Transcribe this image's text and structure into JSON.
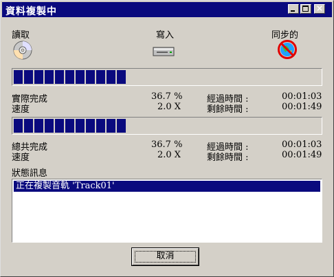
{
  "window": {
    "title": "資料複製中"
  },
  "titlebar": {
    "minimize_icon": "minimize-icon",
    "maximize_icon": "maximize-icon",
    "close_label": "×"
  },
  "header": {
    "read_label": "讀取",
    "write_label": "寫入",
    "sync_label": "同步的",
    "read_icon": "cd-disc-icon",
    "write_icon": "drive-icon",
    "sync_icon": "no-sync-icon"
  },
  "track_progress": {
    "percent": 36.7,
    "complete_label": "實際完成",
    "complete_value": "36.7 %",
    "speed_label": "速度",
    "speed_value": "2.0 X",
    "elapsed_label": "經過時間 :",
    "elapsed_value": "00:01:03",
    "remaining_label": "剩餘時間 :",
    "remaining_value": "00:01:49"
  },
  "total_progress": {
    "percent": 36.7,
    "complete_label": "總共完成",
    "complete_value": "36.7 %",
    "speed_label": "速度",
    "speed_value": "2.0 X",
    "elapsed_label": "經過時間 :",
    "elapsed_value": "00:01:03",
    "remaining_label": "剩餘時間 :",
    "remaining_value": "00:01:49"
  },
  "status": {
    "heading": "狀態訊息",
    "messages": [
      "正在複製音軌 'Track01'"
    ]
  },
  "buttons": {
    "cancel_label": "取消"
  },
  "colors": {
    "titlebar": "#0a0a7e",
    "progress_fill": "#0a0a7e",
    "face": "#d4d0c8"
  }
}
